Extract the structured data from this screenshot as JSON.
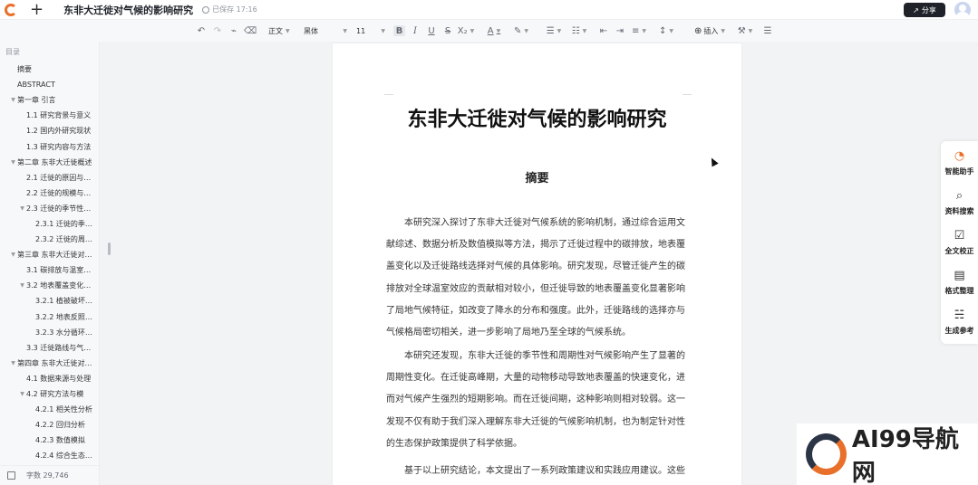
{
  "app": {
    "doc_title": "东非大迁徙对气候的影响研究",
    "saved_status": "已保存 17:16",
    "share_label": "分享",
    "brand_color": "#e8702a"
  },
  "toolbar": {
    "style_select": "正文",
    "font_select": "黑体",
    "size_select": "11",
    "insert_label": "插入"
  },
  "outline": {
    "label": "目录",
    "items": [
      {
        "text": "摘要",
        "level": 1,
        "tri": false
      },
      {
        "text": "ABSTRACT",
        "level": 1,
        "tri": false
      },
      {
        "text": "第一章 引言",
        "level": 0,
        "tri": true
      },
      {
        "text": "1.1 研究背景与意义",
        "level": 2,
        "tri": false
      },
      {
        "text": "1.2 国内外研究现状",
        "level": 2,
        "tri": false
      },
      {
        "text": "1.3 研究内容与方法",
        "level": 2,
        "tri": false
      },
      {
        "text": "第二章 东非大迁徙概述",
        "level": 0,
        "tri": true
      },
      {
        "text": "2.1 迁徙的原因与…",
        "level": 2,
        "tri": false
      },
      {
        "text": "2.2 迁徙的规模与…",
        "level": 2,
        "tri": false
      },
      {
        "text": "2.3 迁徙的季节性…",
        "level": 2,
        "tri": true
      },
      {
        "text": "2.3.1 迁徙的季…",
        "level": 3,
        "tri": false
      },
      {
        "text": "2.3.2 迁徙的周…",
        "level": 3,
        "tri": false
      },
      {
        "text": "第三章 东非大迁徙对…",
        "level": 0,
        "tri": true
      },
      {
        "text": "3.1 碳排放与温室…",
        "level": 2,
        "tri": false
      },
      {
        "text": "3.2 地表覆盖变化…",
        "level": 2,
        "tri": true
      },
      {
        "text": "3.2.1 植被破坏…",
        "level": 3,
        "tri": false
      },
      {
        "text": "3.2.2 地表反照…",
        "level": 3,
        "tri": false
      },
      {
        "text": "3.2.3 水分循环…",
        "level": 3,
        "tri": false
      },
      {
        "text": "3.3 迁徙路线与气…",
        "level": 2,
        "tri": false
      },
      {
        "text": "第四章 东非大迁徙对…",
        "level": 0,
        "tri": true
      },
      {
        "text": "4.1 数据来源与处理",
        "level": 2,
        "tri": false
      },
      {
        "text": "4.2 研究方法与模",
        "level": 2,
        "tri": true
      },
      {
        "text": "4.2.1 相关性分析",
        "level": 3,
        "tri": false
      },
      {
        "text": "4.2.2 回归分析",
        "level": 3,
        "tri": false
      },
      {
        "text": "4.2.3 数值模拟",
        "level": 3,
        "tri": false
      },
      {
        "text": "4.2.4 综合生态…",
        "level": 3,
        "tri": false
      }
    ],
    "word_count": "字数 29,746"
  },
  "document": {
    "title": "东非大迁徙对气候的影响研究",
    "abstract_heading": "摘要",
    "paragraphs": [
      "本研究深入探讨了东非大迁徙对气候系统的影响机制，通过综合运用文献综述、数据分析及数值模拟等方法，揭示了迁徙过程中的碳排放，地表覆盖变化以及迁徙路线选择对气候的具体影响。研究发现，尽管迁徙产生的碳排放对全球温室效应的贡献相对较小，但迁徙导致的地表覆盖变化显著影响了局地气候特征，如改变了降水的分布和强度。此外，迁徙路线的选择亦与气候格局密切相关，进一步影响了局地乃至全球的气候系统。",
      "本研究还发现，东非大迁徙的季节性和周期性对气候影响产生了显著的周期性变化。在迁徙高峰期，大量的动物移动导致地表覆盖的快速变化，进而对气候产生强烈的短期影响。而在迁徙间期，这种影响则相对较弱。这一发现不仅有助于我们深入理解东非大迁徙的气候影响机制，也为制定针对性的生态保护政策提供了科学依据。",
      "基于以上研究结论，本文提出了一系列政策建议和实践应用建议。这些建"
    ]
  },
  "right_panel": {
    "items": [
      {
        "label": "智能助手",
        "icon": "assistant-logo-icon"
      },
      {
        "label": "资料搜索",
        "icon": "search-icon"
      },
      {
        "label": "全文校正",
        "icon": "proofread-icon"
      },
      {
        "label": "格式整理",
        "icon": "format-icon"
      },
      {
        "label": "生成参考",
        "icon": "reference-icon"
      }
    ]
  },
  "watermark": {
    "text": "AI99导航网"
  }
}
